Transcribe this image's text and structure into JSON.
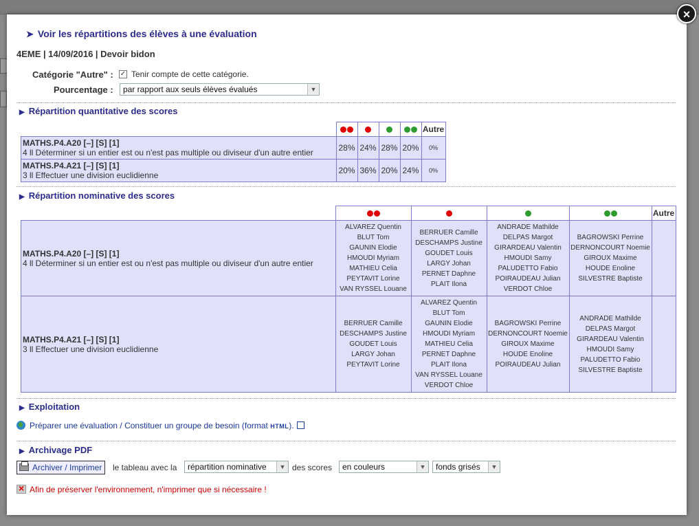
{
  "modal": {
    "title": "Voir les répartitions des élèves à une évaluation",
    "subtitle": "4EME | 14/09/2016 | Devoir bidon"
  },
  "options": {
    "category_label": "Catégorie \"Autre\" :",
    "category_checkbox_label": "Tenir compte de cette catégorie.",
    "category_checked": true,
    "percent_label": "Pourcentage :",
    "percent_value": "par rapport aux seuls élèves évalués"
  },
  "quant": {
    "section_title": "Répartition quantitative des scores",
    "other_header": "Autre",
    "rows": [
      {
        "code": "MATHS.P4.A20 [–] [S] [1]",
        "desc": "4 ll Déterminer si un entier est ou n'est pas multiple ou diviseur d'un autre entier",
        "values": [
          "28%",
          "24%",
          "28%",
          "20%",
          "0%"
        ]
      },
      {
        "code": "MATHS.P4.A21 [–] [S] [1]",
        "desc": "3 ll Effectuer une division euclidienne",
        "values": [
          "20%",
          "36%",
          "20%",
          "24%",
          "0%"
        ]
      }
    ]
  },
  "nominal": {
    "section_title": "Répartition nominative des scores",
    "other_header": "Autre",
    "rows": [
      {
        "code": "MATHS.P4.A20 [–] [S] [1]",
        "desc": "4 ll Déterminer si un entier est ou n'est pas multiple ou diviseur d'un autre entier",
        "cols": [
          "ALVAREZ Quentin\nBLUT Tom\nGAUNIN Elodie\nHMOUDI Myriam\nMATHIEU Celia\nPEYTAVIT Lorine\nVAN RYSSEL Louane",
          "BERRUER Camille\nDESCHAMPS Justine\nGOUDET Louis\nLARGY Johan\nPERNET Daphne\nPLAIT Ilona",
          "ANDRADE Mathilde\nDELPAS Margot\nGIRARDEAU Valentin\nHMOUDI Samy\nPALUDETTO Fabio\nPOIRAUDEAU Julian\nVERDOT Chloe",
          "BAGROWSKI Perrine\nDERNONCOURT Noemie\nGIROUX Maxime\nHOUDE Enoline\nSILVESTRE Baptiste",
          ""
        ]
      },
      {
        "code": "MATHS.P4.A21 [–] [S] [1]",
        "desc": "3 ll Effectuer une division euclidienne",
        "cols": [
          "BERRUER Camille\nDESCHAMPS Justine\nGOUDET Louis\nLARGY Johan\nPEYTAVIT Lorine",
          "ALVAREZ Quentin\nBLUT Tom\nGAUNIN Elodie\nHMOUDI Myriam\nMATHIEU Celia\nPERNET Daphne\nPLAIT Ilona\nVAN RYSSEL Louane\nVERDOT Chloe",
          "BAGROWSKI Perrine\nDERNONCOURT Noemie\nGIROUX Maxime\nHOUDE Enoline\nPOIRAUDEAU Julian",
          "ANDRADE Mathilde\nDELPAS Margot\nGIRARDEAU Valentin\nHMOUDI Samy\nPALUDETTO Fabio\nSILVESTRE Baptiste",
          ""
        ]
      }
    ]
  },
  "exploitation": {
    "section_title": "Exploitation",
    "link_text": "Préparer une évaluation / Constituer un groupe de besoin (format ",
    "link_format": "HTML",
    "link_suffix": ")."
  },
  "archive": {
    "section_title": "Archivage PDF",
    "button_label": "Archiver / Imprimer",
    "text1": "le tableau avec la",
    "select1_value": "répartition nominative",
    "text2": "des scores",
    "select2_value": "en couleurs",
    "select3_value": "fonds grisés",
    "warning": "Afin de préserver l'environnement, n'imprimer que si nécessaire !"
  },
  "colors": {
    "red": "#e00000",
    "green": "#2e9b2e",
    "accent": "#2c2c8c",
    "cell_bg": "#e0e0fa"
  },
  "icons": [
    "close-icon",
    "chevron-right-icon",
    "triangle-right-icon",
    "checkbox-icon",
    "globe-icon",
    "external-link-icon",
    "printer-icon",
    "no-print-icon"
  ]
}
